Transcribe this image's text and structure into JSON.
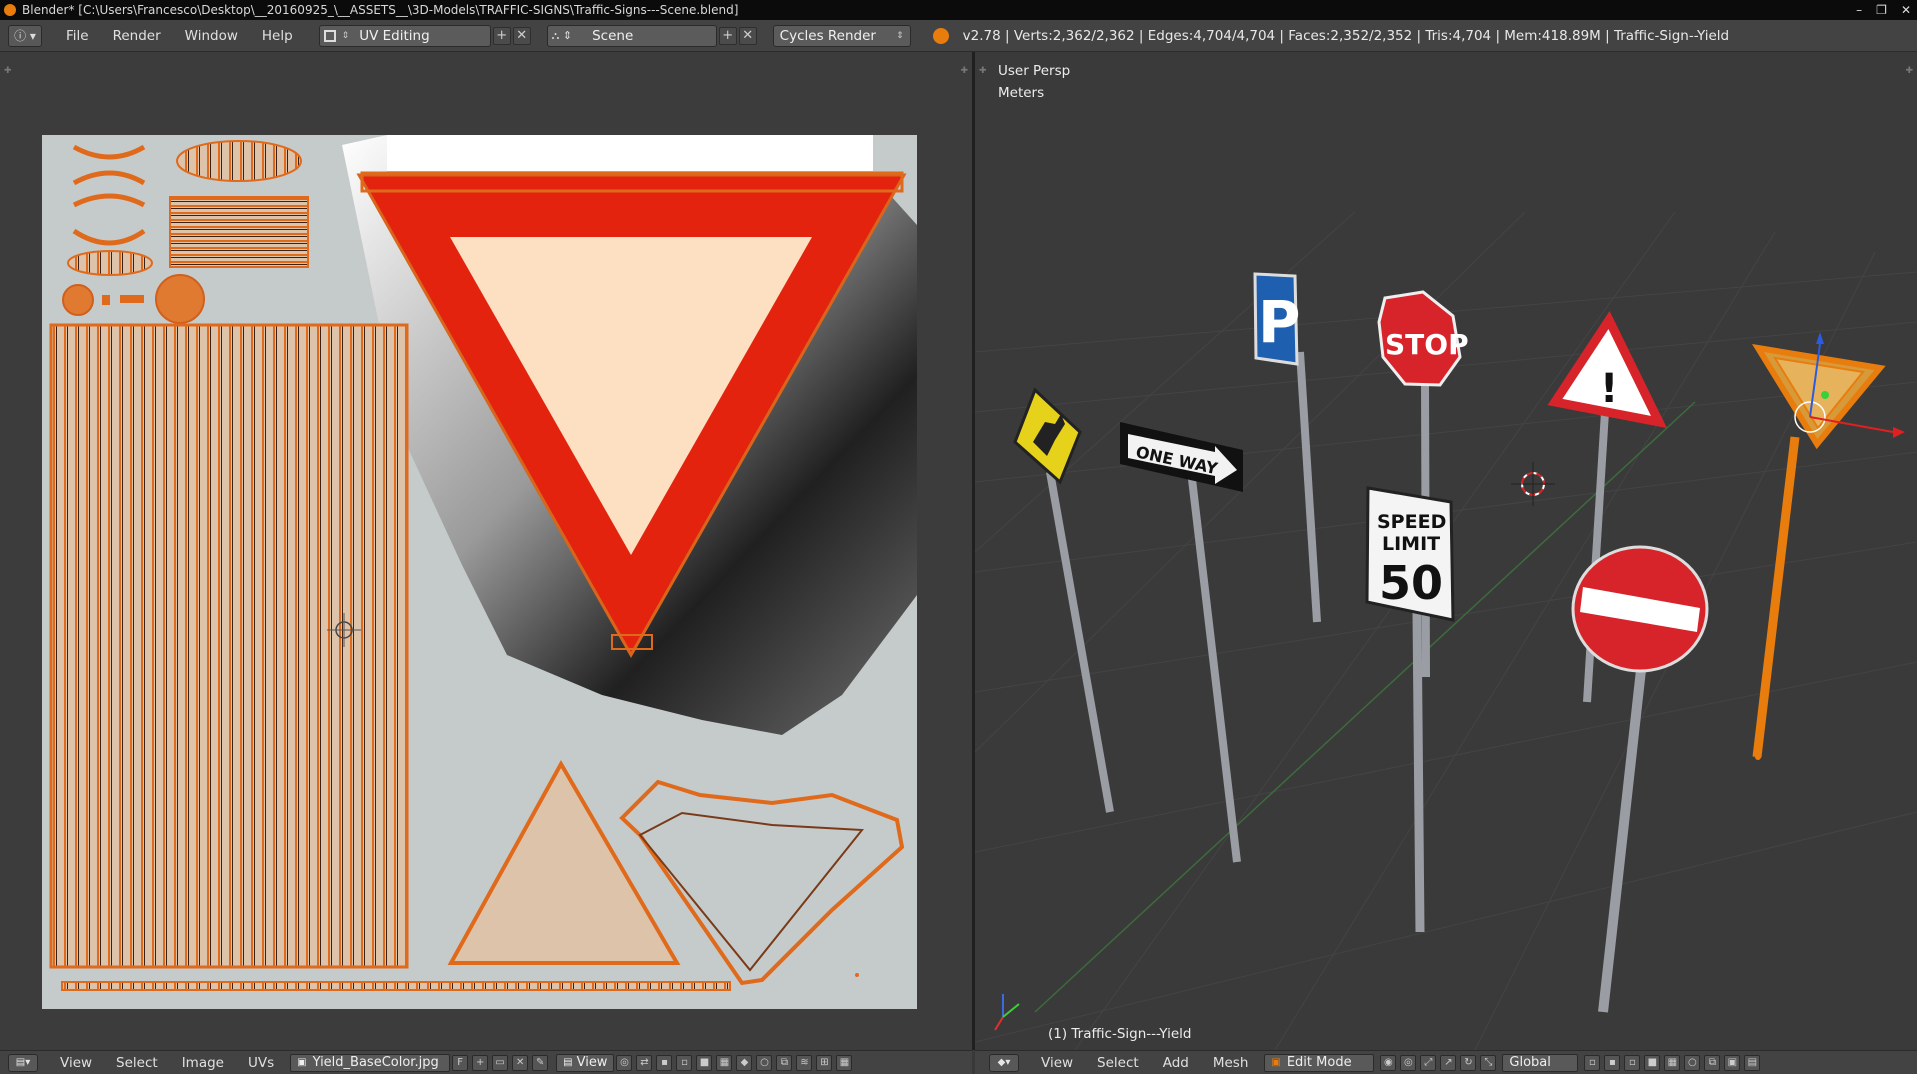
{
  "window": {
    "title": "Blender* [C:\\Users\\Francesco\\Desktop\\__20160925_\\__ASSETS__\\3D-Models\\TRAFFIC-SIGNS\\Traffic-Signs---Scene.blend]",
    "controls": [
      "–",
      "❐",
      "✕"
    ]
  },
  "info_header": {
    "menus": [
      "File",
      "Render",
      "Window",
      "Help"
    ],
    "layout": "UV Editing",
    "scene": "Scene",
    "render_engine": "Cycles Render",
    "stats": "v2.78 | Verts:2,362/2,362 | Edges:4,704/4,704 | Faces:2,352/2,352 | Tris:4,704 | Mem:418.89M | Traffic-Sign--Yield"
  },
  "viewport": {
    "view_name": "User Persp",
    "units": "Meters",
    "object_label": "(1) Traffic-Sign---Yield",
    "signs": {
      "stop": "STOP",
      "one_way": "ONE WAY",
      "parking": "P",
      "speed_limit_line1": "SPEED",
      "speed_limit_line2": "LIMIT",
      "speed_limit_value": "50",
      "warning": "!"
    }
  },
  "uv_editor_footer": {
    "menus": [
      "View",
      "Select",
      "Image",
      "UVs"
    ],
    "image_name": "Yield_BaseColor.jpg",
    "fake_user": "F",
    "view_label": "View"
  },
  "viewport_footer": {
    "menus": [
      "View",
      "Select",
      "Add",
      "Mesh"
    ],
    "mode": "Edit Mode",
    "orientation": "Global"
  },
  "colors": {
    "accent_orange": "#e87d0d",
    "yield_red": "#e3230d",
    "yield_fill": "#fde0c2",
    "sign_blue": "#1f5fb0",
    "sign_yellow": "#e6d21a"
  }
}
